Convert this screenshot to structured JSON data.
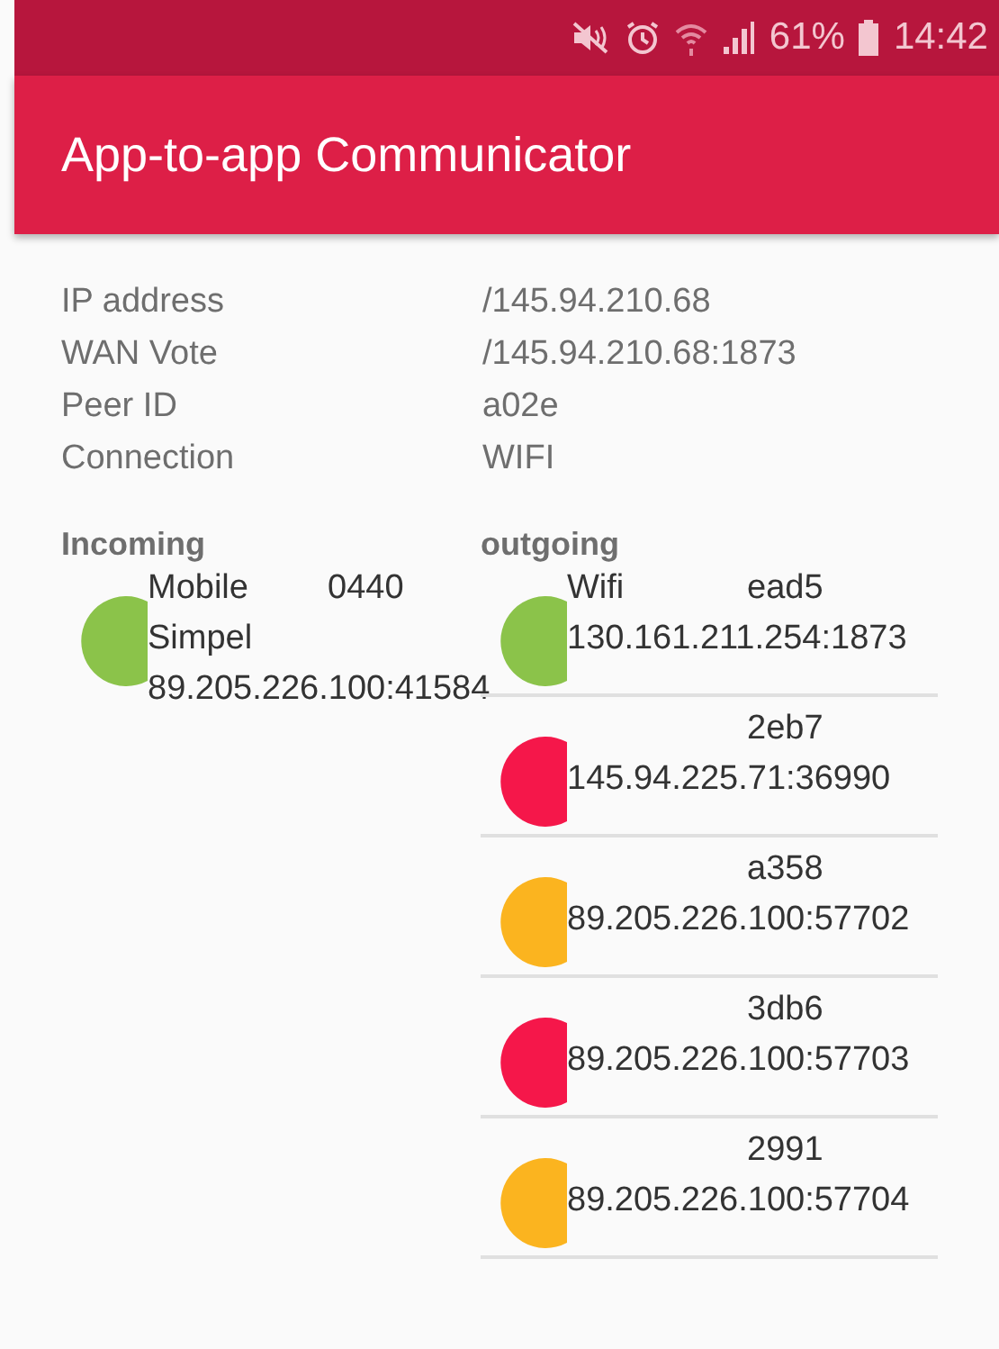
{
  "status_bar": {
    "battery": "61%",
    "time": "14:42"
  },
  "app_bar": {
    "title": "App-to-app Communicator"
  },
  "info": [
    {
      "label": "IP address",
      "value": "/145.94.210.68"
    },
    {
      "label": "WAN Vote",
      "value": "/145.94.210.68:1873"
    },
    {
      "label": "Peer ID",
      "value": "a02e"
    },
    {
      "label": "Connection",
      "value": "WIFI"
    }
  ],
  "incoming": {
    "title": "Incoming",
    "peers": [
      {
        "color": "#8bc34a",
        "network": "Mobile",
        "id": "0440",
        "carrier": "Simpel",
        "address": "89.205.226.100:41584"
      }
    ]
  },
  "outgoing": {
    "title": "outgoing",
    "peers": [
      {
        "color": "#8bc34a",
        "network": "Wifi",
        "id": "ead5",
        "address": "130.161.211.254:1873"
      },
      {
        "color": "#f5174a",
        "id": "2eb7",
        "address": "145.94.225.71:36990"
      },
      {
        "color": "#fbb41f",
        "id": "a358",
        "address": "89.205.226.100:57702"
      },
      {
        "color": "#f5174a",
        "id": "3db6",
        "address": "89.205.226.100:57703"
      },
      {
        "color": "#fbb41f",
        "id": "2991",
        "address": "89.205.226.100:57704"
      }
    ]
  }
}
